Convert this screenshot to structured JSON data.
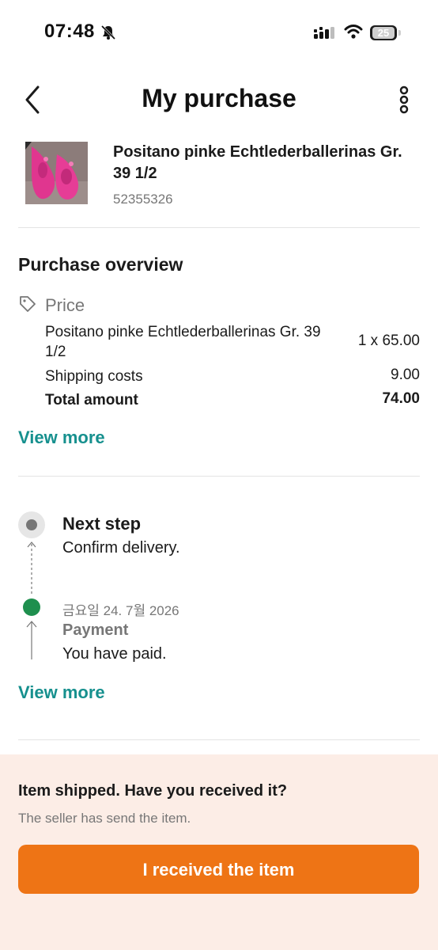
{
  "status_bar": {
    "time": "07:48",
    "battery": "25",
    "icons": [
      "bell-muted-icon",
      "signal-icon",
      "wifi-icon",
      "battery-icon"
    ]
  },
  "header": {
    "title": "My purchase",
    "icons": [
      "back-arrow-icon",
      "more-vertical-icon"
    ]
  },
  "product": {
    "title": "Positano pinke Echtlederballerinas Gr. 39 1/2",
    "id": "52355326"
  },
  "overview": {
    "title": "Purchase overview",
    "price_label": "Price",
    "lines": [
      {
        "label": "Positano pinke Echtlederballerinas Gr. 39 1/2",
        "value": "1 x 65.00"
      },
      {
        "label": "Shipping costs",
        "value": "9.00"
      },
      {
        "label": "Total amount",
        "value": "74.00"
      }
    ],
    "view_more": "View more"
  },
  "timeline": {
    "next_step_title": "Next step",
    "next_step_text": "Confirm delivery.",
    "date": "금요일 24. 7월 2026",
    "payment_title": "Payment",
    "payment_text": "You have paid.",
    "view_more": "View more"
  },
  "footer": {
    "title": "Item shipped. Have you received it?",
    "subtitle": "The seller has send the item.",
    "button": "I received the item"
  },
  "colors": {
    "accent_teal": "#16908e",
    "button_orange": "#ee7415",
    "footer_bg": "#fcede6",
    "completed_green": "#1e8f4e"
  }
}
